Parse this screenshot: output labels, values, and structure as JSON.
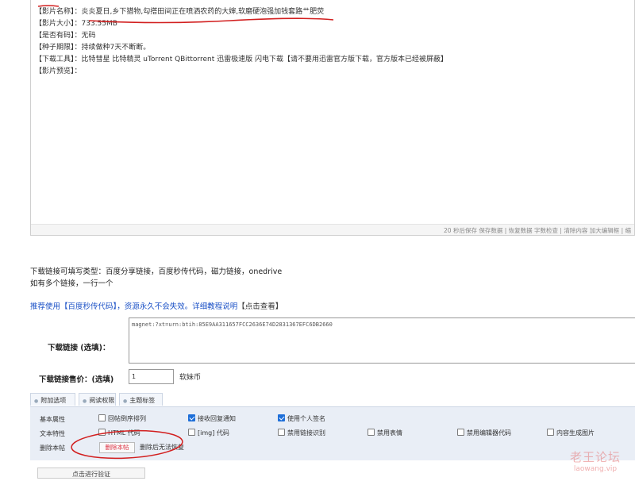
{
  "editor": {
    "lines": [
      {
        "key": "【影片名称】",
        "value": "：炎炎夏日,乡下猎物,勾搭田间正在喷洒农药的大婶,软磨硬泡强加钱套路艹肥荧"
      },
      {
        "key": "【影片大小】",
        "value": "：733.55MB"
      },
      {
        "key": "【是否有码】",
        "value": "：无码"
      },
      {
        "key": "【种子期限】",
        "value": "：持续做种7天不断断。"
      },
      {
        "key": "【下载工具】",
        "value": "：比特彗星 比特精灵 uTorrent QBittorrent 迅雷极速版 闪电下载【请不要用迅雷官方版下载，官方版本已经被屏蔽】"
      },
      {
        "key": "【影片预览】",
        "value": "："
      }
    ],
    "status_text": "20 秒后保存 保存数据 | 恢复数据    字数检查 | 清除内容    加大编辑框 | 缩"
  },
  "notes": {
    "line1": "下载链接可填写类型：百度分享链接，百度秒传代码，磁力链接，onedrive",
    "line2": "如有多个链接，一行一个"
  },
  "recommend": {
    "text": "推荐使用【百度秒传代码】，资源永久不会失效。详细教程说明",
    "link": "【点击查看】"
  },
  "download": {
    "label": "下载链接 (选填)：",
    "value": "magnet:?xt=urn:btih:85E9AA311657FCC2636E74D2831367EFC6DB2660"
  },
  "price": {
    "label": "下载链接售价：(选填)",
    "value": "1",
    "unit": "软妹币"
  },
  "tabs": [
    {
      "label": "附加选项"
    },
    {
      "label": "阅读权限"
    },
    {
      "label": "主题标签"
    }
  ],
  "options": {
    "basic_label": "基本属性",
    "text_label": "文本特性",
    "delete_label": "删除本帖",
    "basic": [
      {
        "label": "回帖倒序排列",
        "checked": false
      },
      {
        "label": "接收回复通知",
        "checked": true
      },
      {
        "label": "使用个人签名",
        "checked": true
      }
    ],
    "text": [
      {
        "label": "HTML 代码",
        "checked": false
      },
      {
        "label": "[img] 代码",
        "checked": false
      },
      {
        "label": "禁用链接识别",
        "checked": false
      },
      {
        "label": "禁用表情",
        "checked": false
      },
      {
        "label": "禁用编辑器代码",
        "checked": false
      },
      {
        "label": "内容生成图片",
        "checked": false
      }
    ],
    "delete_button": "删除本帖",
    "delete_note": "删除后无法恢复"
  },
  "verify_button": "点击进行验证",
  "watermark": {
    "line1": "老王论坛",
    "line2": "laowang.vip"
  },
  "colors": {
    "accent": "#1e6fd9",
    "link": "#1a50c6",
    "annotation": "#d21f1f"
  }
}
